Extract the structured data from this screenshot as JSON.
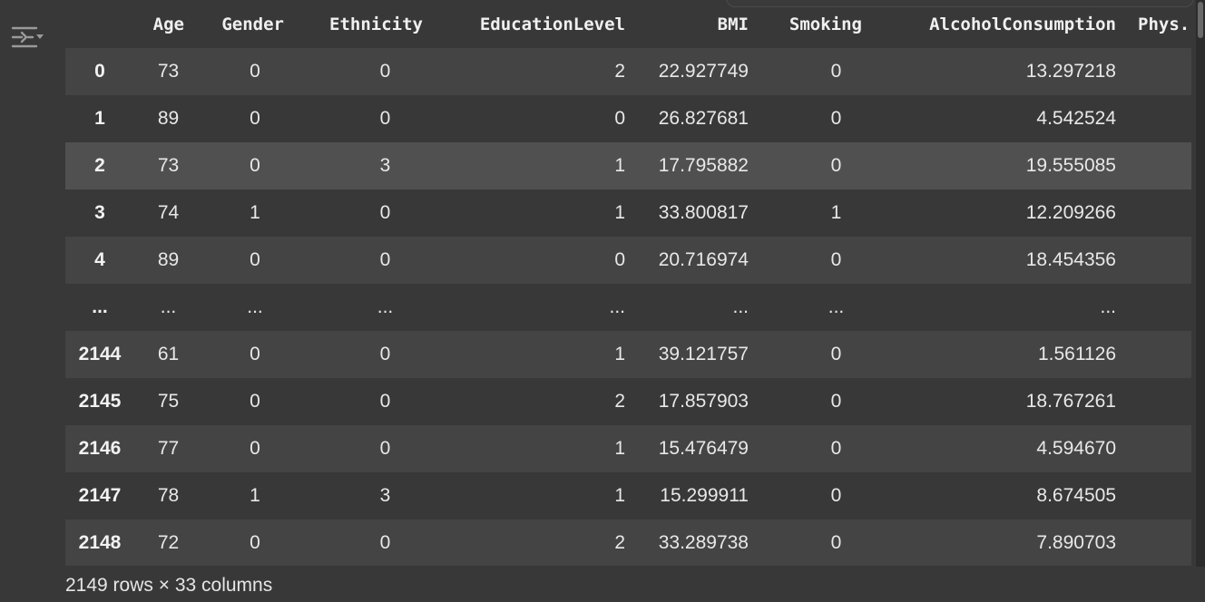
{
  "table": {
    "columns": [
      "",
      "Age",
      "Gender",
      "Ethnicity",
      "EducationLevel",
      "BMI",
      "Smoking",
      "AlcoholConsumption",
      "Phys."
    ],
    "rows": [
      {
        "idx": "0",
        "cells": [
          "73",
          "0",
          "0",
          "2",
          "22.927749",
          "0",
          "13.297218",
          ""
        ]
      },
      {
        "idx": "1",
        "cells": [
          "89",
          "0",
          "0",
          "0",
          "26.827681",
          "0",
          "4.542524",
          ""
        ]
      },
      {
        "idx": "2",
        "cells": [
          "73",
          "0",
          "3",
          "1",
          "17.795882",
          "0",
          "19.555085",
          ""
        ]
      },
      {
        "idx": "3",
        "cells": [
          "74",
          "1",
          "0",
          "1",
          "33.800817",
          "1",
          "12.209266",
          ""
        ]
      },
      {
        "idx": "4",
        "cells": [
          "89",
          "0",
          "0",
          "0",
          "20.716974",
          "0",
          "18.454356",
          ""
        ]
      },
      {
        "idx": "...",
        "cells": [
          "...",
          "...",
          "...",
          "...",
          "...",
          "...",
          "...",
          ""
        ]
      },
      {
        "idx": "2144",
        "cells": [
          "61",
          "0",
          "0",
          "1",
          "39.121757",
          "0",
          "1.561126",
          ""
        ]
      },
      {
        "idx": "2145",
        "cells": [
          "75",
          "0",
          "0",
          "2",
          "17.857903",
          "0",
          "18.767261",
          ""
        ]
      },
      {
        "idx": "2146",
        "cells": [
          "77",
          "0",
          "0",
          "1",
          "15.476479",
          "0",
          "4.594670",
          ""
        ]
      },
      {
        "idx": "2147",
        "cells": [
          "78",
          "1",
          "3",
          "1",
          "15.299911",
          "0",
          "8.674505",
          ""
        ]
      },
      {
        "idx": "2148",
        "cells": [
          "72",
          "0",
          "0",
          "2",
          "33.289738",
          "0",
          "7.890703",
          ""
        ]
      }
    ],
    "highlighted_row": "2"
  },
  "footer": {
    "shape_text": "2149 rows × 33 columns"
  },
  "icons": {
    "toggle": "output-toggle-icon"
  },
  "colors": {
    "background": "#383838",
    "row_alt": "#444444",
    "row_hover": "#505050",
    "text": "#e8e8e8"
  }
}
